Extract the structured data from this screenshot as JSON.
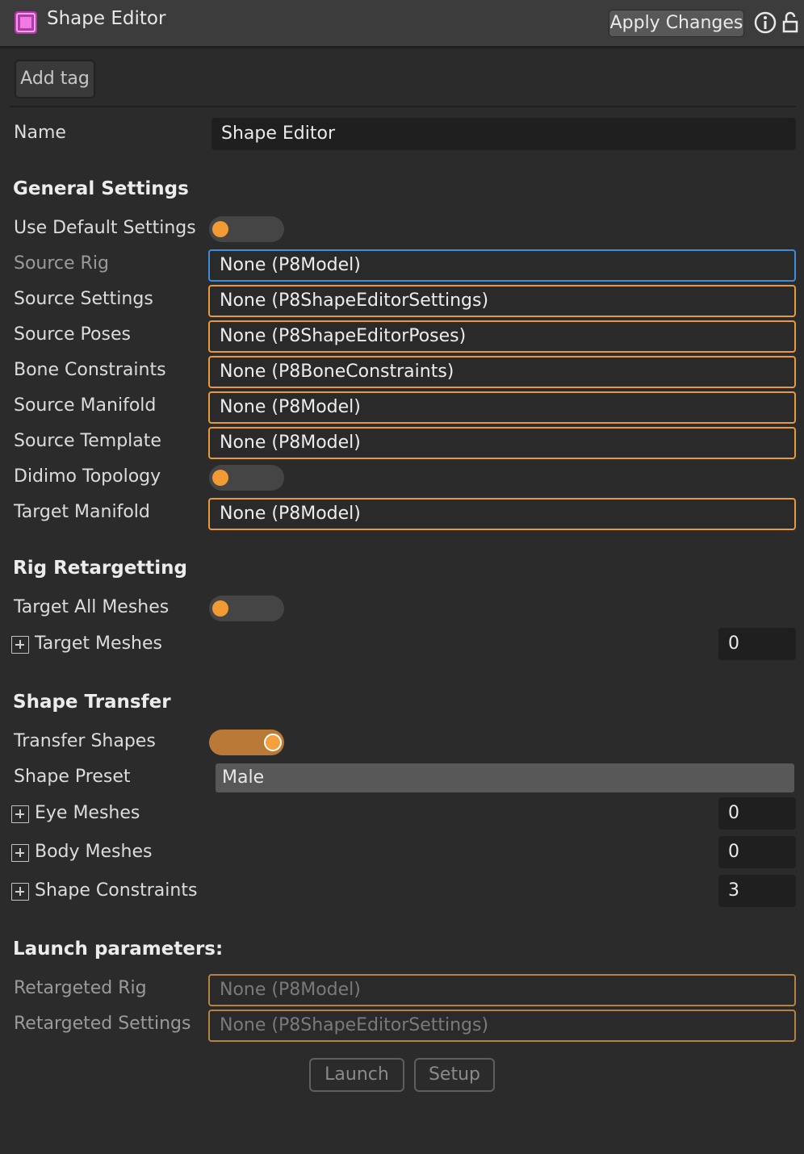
{
  "header": {
    "title": "Shape Editor",
    "apply_label": "Apply Changes"
  },
  "tags": {
    "add_label": "Add tag"
  },
  "name": {
    "label": "Name",
    "value": "Shape Editor"
  },
  "general": {
    "title": "General Settings",
    "use_default": {
      "label": "Use Default Settings",
      "on": false
    },
    "source_rig": {
      "label": "Source Rig",
      "value": "None (P8Model)"
    },
    "source_settings": {
      "label": "Source Settings",
      "value": "None (P8ShapeEditorSettings)"
    },
    "source_poses": {
      "label": "Source Poses",
      "value": "None (P8ShapeEditorPoses)"
    },
    "bone_constraints": {
      "label": "Bone Constraints",
      "value": "None (P8BoneConstraints)"
    },
    "source_manifold": {
      "label": "Source Manifold",
      "value": "None (P8Model)"
    },
    "source_template": {
      "label": "Source Template",
      "value": "None (P8Model)"
    },
    "didimo_topology": {
      "label": "Didimo Topology",
      "on": false
    },
    "target_manifold": {
      "label": "Target Manifold",
      "value": "None (P8Model)"
    }
  },
  "rig": {
    "title": "Rig Retargetting",
    "target_all": {
      "label": "Target All Meshes",
      "on": false
    },
    "target_meshes": {
      "label": "Target Meshes",
      "count": "0"
    }
  },
  "shape": {
    "title": "Shape Transfer",
    "transfer": {
      "label": "Transfer Shapes",
      "on": true
    },
    "preset": {
      "label": "Shape Preset",
      "value": "Male"
    },
    "eye_meshes": {
      "label": "Eye Meshes",
      "count": "0"
    },
    "body_meshes": {
      "label": "Body Meshes",
      "count": "0"
    },
    "constraints": {
      "label": "Shape Constraints",
      "count": "3"
    }
  },
  "launch": {
    "title": "Launch parameters:",
    "retargeted_rig": {
      "label": "Retargeted Rig",
      "value": "None (P8Model)"
    },
    "retargeted_settings": {
      "label": "Retargeted Settings",
      "value": "None (P8ShapeEditorSettings)"
    },
    "launch_label": "Launch",
    "setup_label": "Setup"
  },
  "colors": {
    "accent": "#f29a33",
    "focus": "#3c8dde",
    "background": "#2b2b2b"
  },
  "icons": [
    "shape-editor-icon",
    "info-icon",
    "lock-icon",
    "plus-box-icon"
  ]
}
